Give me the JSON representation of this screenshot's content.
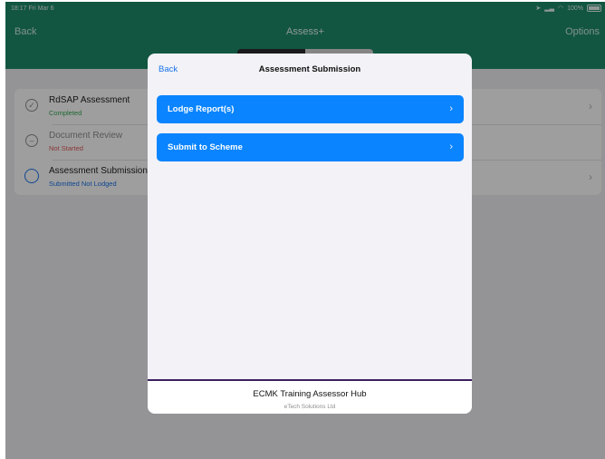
{
  "status_bar": {
    "time": "18:17",
    "day": "Fri Mar 6",
    "battery": "100%"
  },
  "nav": {
    "back": "Back",
    "title": "Assess+",
    "options": "Options"
  },
  "list": {
    "items": [
      {
        "title": "RdSAP Assessment",
        "status": "Completed",
        "status_color": "#34a853"
      },
      {
        "title": "Document Review",
        "status": "Not Started",
        "status_color": "#e05a5a"
      },
      {
        "title": "Assessment Submission",
        "status": "Submitted Not Lodged",
        "status_color": "#1a73e8"
      }
    ]
  },
  "modal": {
    "back": "Back",
    "title": "Assessment Submission",
    "buttons": [
      {
        "label": "Lodge Report(s)"
      },
      {
        "label": "Submit to Scheme"
      }
    ],
    "footer": {
      "org": "ECMK Training Assessor Hub",
      "company": "eTech Solutions Ltd"
    }
  },
  "colors": {
    "header": "#1e8c6a",
    "accent": "#0a84ff",
    "footer_line": "#3b2060"
  }
}
